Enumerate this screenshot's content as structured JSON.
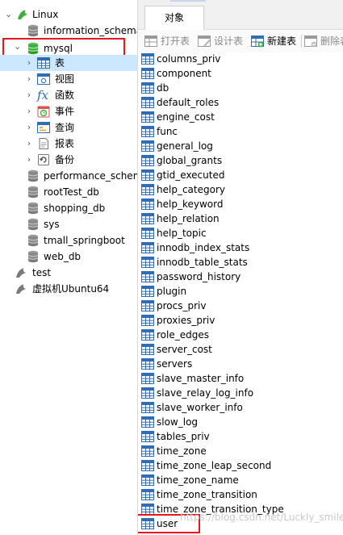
{
  "tree": {
    "connection_linux": "Linux",
    "db_information_schema": "information_schema",
    "db_mysql": "mysql",
    "mysql_children": {
      "tables": "表",
      "views": "视图",
      "functions": "函数",
      "events": "事件",
      "queries": "查询",
      "reports": "报表",
      "backups": "备份"
    },
    "db_performance_schema": "performance_schema",
    "db_roottest": "rootTest_db",
    "db_shopping": "shopping_db",
    "db_sys": "sys",
    "db_tmall": "tmall_springboot",
    "db_web": "web_db",
    "connection_test": "test",
    "connection_vm": "虚拟机Ubuntu64"
  },
  "tabs": {
    "objects": "对象"
  },
  "toolbar": {
    "open_table": "打开表",
    "design_table": "设计表",
    "new_table": "新建表",
    "delete_table": "删除表"
  },
  "tables": [
    "columns_priv",
    "component",
    "db",
    "default_roles",
    "engine_cost",
    "func",
    "general_log",
    "global_grants",
    "gtid_executed",
    "help_category",
    "help_keyword",
    "help_relation",
    "help_topic",
    "innodb_index_stats",
    "innodb_table_stats",
    "password_history",
    "plugin",
    "procs_priv",
    "proxies_priv",
    "role_edges",
    "server_cost",
    "servers",
    "slave_master_info",
    "slave_relay_log_info",
    "slave_worker_info",
    "slow_log",
    "tables_priv",
    "time_zone",
    "time_zone_leap_second",
    "time_zone_name",
    "time_zone_transition",
    "time_zone_transition_type",
    "user"
  ],
  "watermark": "https://blog.csdn.net/Luckly_smile",
  "colors": {
    "highlight": "#e8171e",
    "selection": "#cce8ff",
    "table_icon": "#2f6db5",
    "db_icon": "#4caf50"
  }
}
